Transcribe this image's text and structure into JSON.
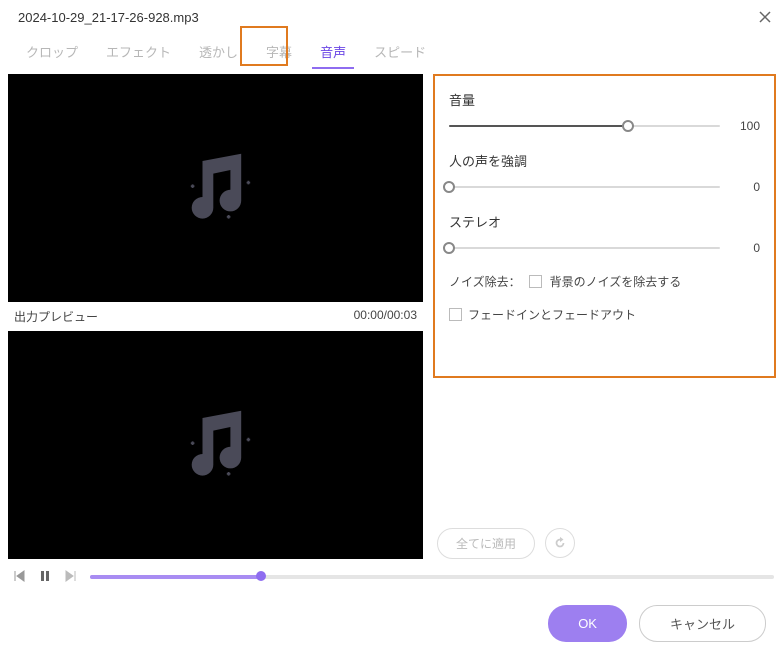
{
  "title": "2024-10-29_21-17-26-928.mp3",
  "tabs": {
    "crop": "クロップ",
    "effect": "エフェクト",
    "watermark": "透かし",
    "subtitle": "字幕",
    "audio": "音声",
    "speed": "スピード"
  },
  "preview": {
    "output_label": "出力プレビュー",
    "time_display": "00:00/00:03"
  },
  "controls": {
    "volume": {
      "label": "音量",
      "value": "100",
      "percent": 66
    },
    "voice": {
      "label": "人の声を強調",
      "value": "0",
      "percent": 0
    },
    "stereo": {
      "label": "ステレオ",
      "value": "0",
      "percent": 0
    },
    "noise": {
      "label": "ノイズ除去：",
      "check_label": "背景のノイズを除去する"
    },
    "fade": {
      "check_label": "フェードインとフェードアウト"
    }
  },
  "apply_all": "全てに適用",
  "buttons": {
    "ok": "OK",
    "cancel": "キャンセル"
  }
}
